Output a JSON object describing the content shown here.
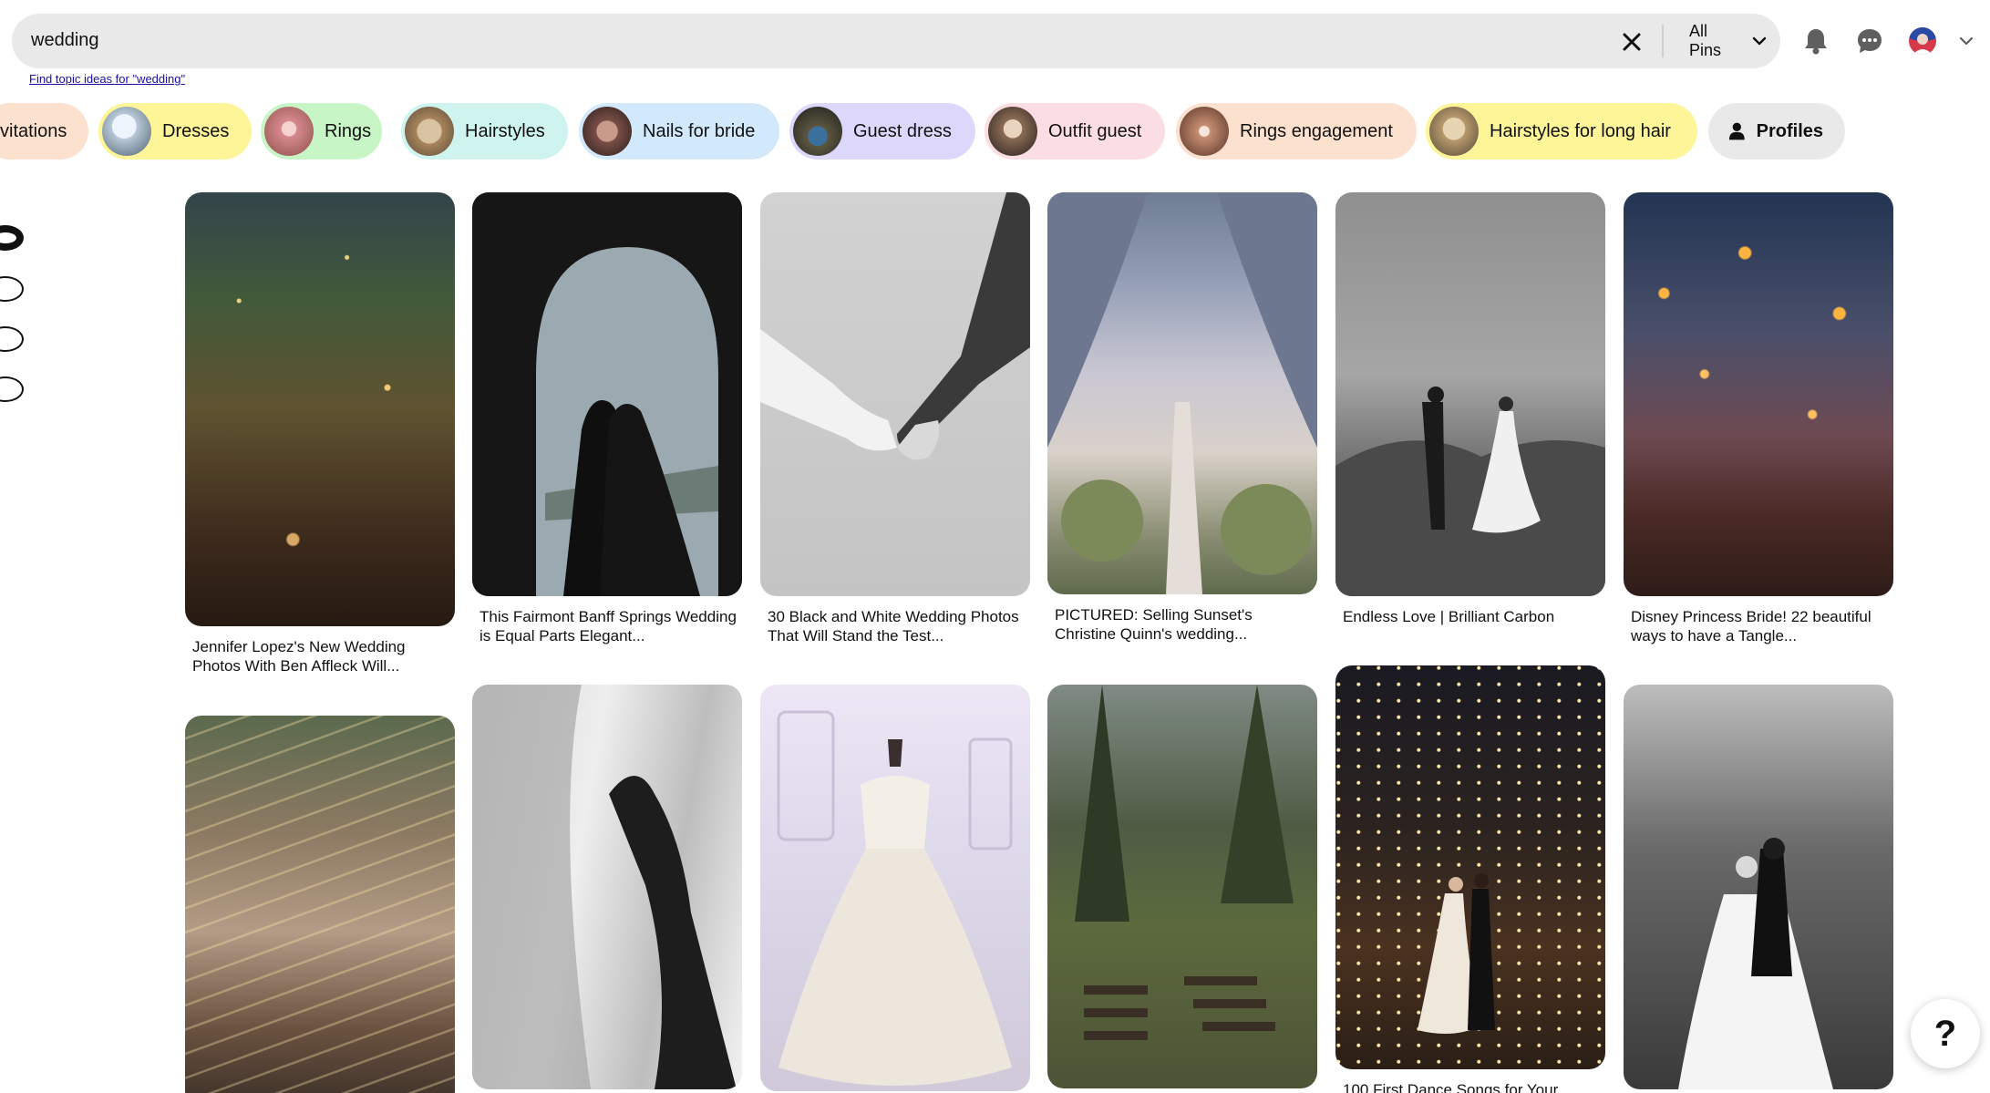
{
  "search": {
    "query": "wedding",
    "filter_label": "All Pins",
    "topic_link": "Find topic ideas for \"wedding\""
  },
  "chips": [
    {
      "label": "vitations",
      "color": "#fde1cf"
    },
    {
      "label": "Dresses",
      "color": "#fdf597"
    },
    {
      "label": "Rings",
      "color": "#c8f5c6"
    },
    {
      "label": "Hairstyles",
      "color": "#cff4ef"
    },
    {
      "label": "Nails for bride",
      "color": "#d2e8fb"
    },
    {
      "label": "Guest dress",
      "color": "#ddd7fb"
    },
    {
      "label": "Outfit guest",
      "color": "#fbdde4"
    },
    {
      "label": "Rings engagement",
      "color": "#fde1cf"
    },
    {
      "label": "Hairstyles for long hair",
      "color": "#fdf597"
    },
    {
      "label": "Profiles",
      "color": "#e9e9e9"
    }
  ],
  "pins": {
    "row1": [
      {
        "caption": "Jennifer Lopez's New Wedding Photos With Ben Affleck Will..."
      },
      {
        "caption": "This Fairmont Banff Springs Wedding is Equal Parts Elegant..."
      },
      {
        "caption": "30 Black and White Wedding Photos That Will Stand the Test..."
      },
      {
        "caption": "PICTURED: Selling Sunset's Christine Quinn's wedding..."
      },
      {
        "caption": "Endless Love | Brilliant Carbon"
      },
      {
        "caption": "Disney Princess Bride! 22 beautiful ways to have a Tangle..."
      }
    ],
    "row2": [
      {
        "caption": ""
      },
      {
        "caption": ""
      },
      {
        "caption": ""
      },
      {
        "caption": ""
      },
      {
        "caption": "100 First Dance Songs for Your"
      },
      {
        "caption": ""
      }
    ]
  },
  "help": {
    "label": "?"
  },
  "icons": [
    "close-icon",
    "chevron-down-icon",
    "bell-icon",
    "messages-icon",
    "avatar",
    "person-icon",
    "help-icon"
  ]
}
